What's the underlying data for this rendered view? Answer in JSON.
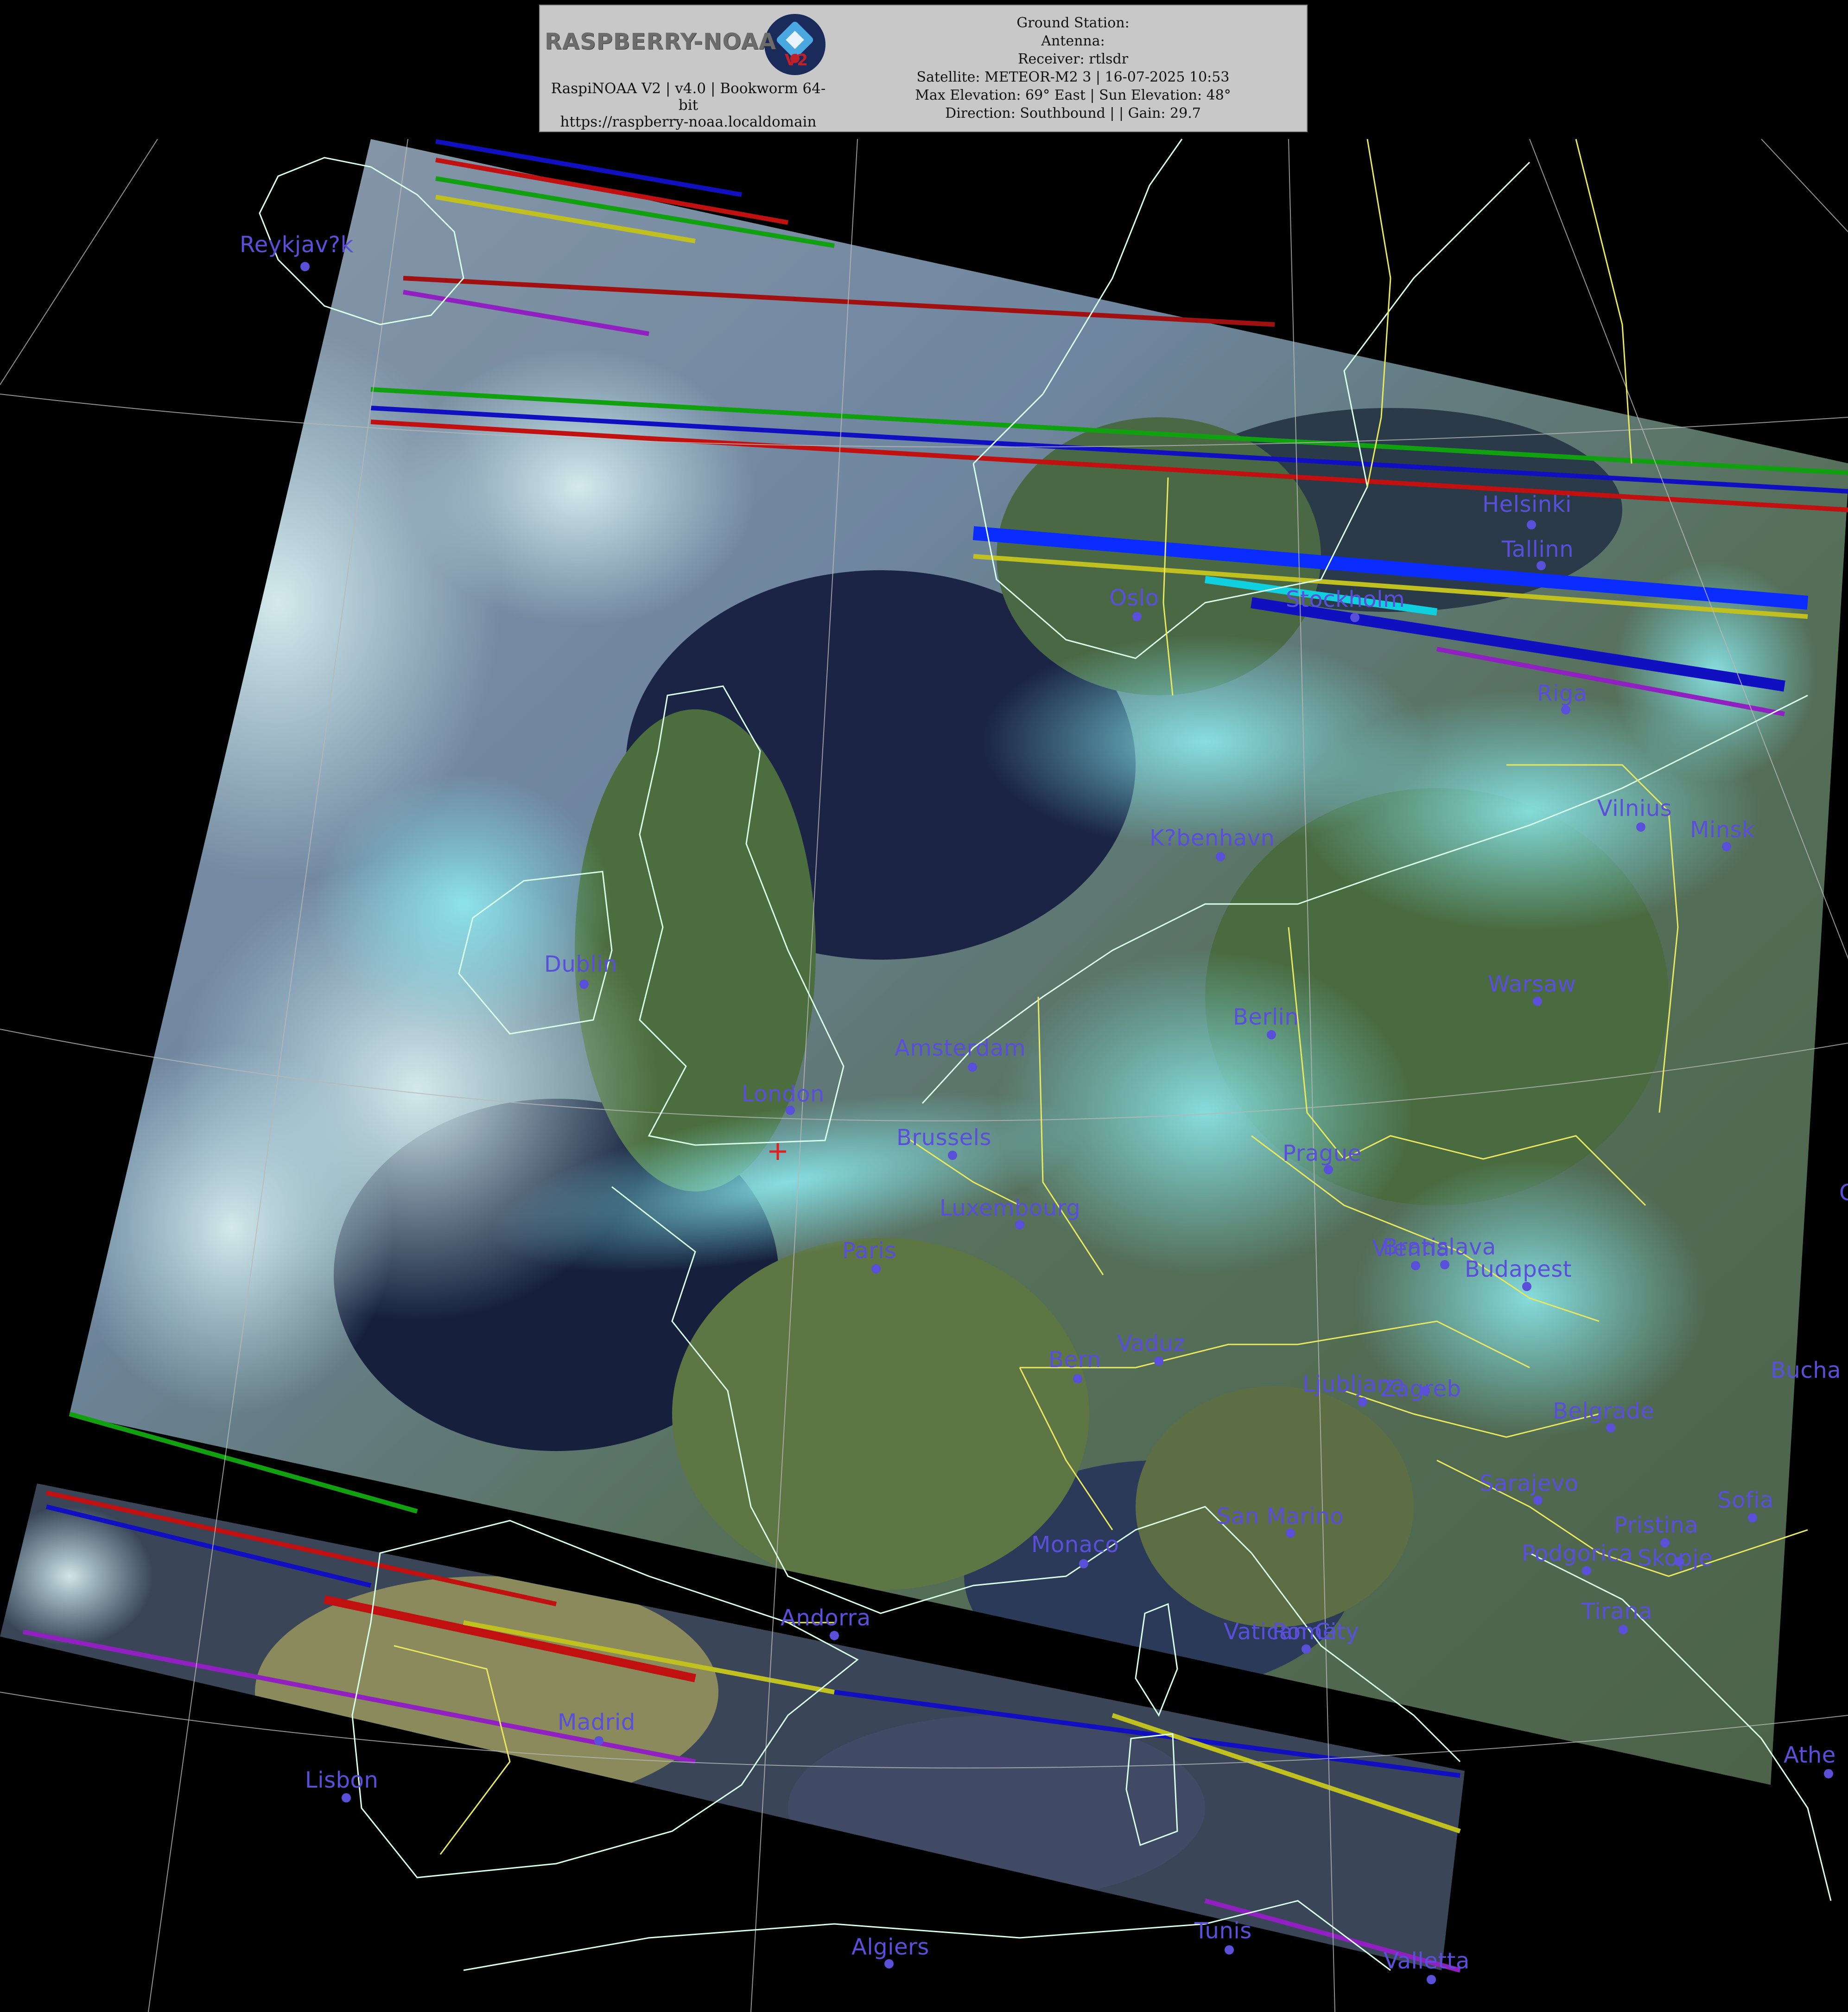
{
  "header": {
    "logo_text": "RASPBERRY-NOAA",
    "logo_version": "V2",
    "station_line1": "RaspiNOAA V2 | v4.0 | Bookworm 64-",
    "station_line1b": "bit",
    "station_url": "https://raspberry-noaa.localdomain",
    "ground_station": "Ground Station:",
    "antenna": "Antenna:",
    "receiver": "Receiver: rtlsdr",
    "satellite": "Satellite: METEOR-M2 3 | 16-07-2025 10:53",
    "elevation": "Max Elevation: 69° East | Sun Elevation: 48°",
    "direction": "Direction: Southbound | | Gain: 29.7"
  },
  "colors": {
    "label": "#5a4fd8",
    "coastline": "#d8ffe8",
    "border": "#e8e860",
    "grid": "#bcbcbc",
    "ground_station_marker": "#e02020"
  },
  "cities": [
    {
      "name": "Reykjav?k"
    },
    {
      "name": "Helsinki"
    },
    {
      "name": "Tallinn"
    },
    {
      "name": "Oslo"
    },
    {
      "name": "Stockholm"
    },
    {
      "name": "Riga"
    },
    {
      "name": "Vilnius"
    },
    {
      "name": "Minsk"
    },
    {
      "name": "K?benhavn"
    },
    {
      "name": "Dublin"
    },
    {
      "name": "Warsaw"
    },
    {
      "name": "Berlin"
    },
    {
      "name": "Amsterdam"
    },
    {
      "name": "London"
    },
    {
      "name": "Brussels"
    },
    {
      "name": "Prague"
    },
    {
      "name": "Luxembourg"
    },
    {
      "name": "Paris"
    },
    {
      "name": "Vienna"
    },
    {
      "name": "Bratislava"
    },
    {
      "name": "Budapest"
    },
    {
      "name": "Vaduz"
    },
    {
      "name": "Bern"
    },
    {
      "name": "Ljubljana"
    },
    {
      "name": "Zagreb"
    },
    {
      "name": "Bucha"
    },
    {
      "name": "Belgrade"
    },
    {
      "name": "Sarajevo"
    },
    {
      "name": "San Marino"
    },
    {
      "name": "Sofia"
    },
    {
      "name": "Pristina"
    },
    {
      "name": "Monaco"
    },
    {
      "name": "Podgorica"
    },
    {
      "name": "Skopje"
    },
    {
      "name": "Tirana"
    },
    {
      "name": "Andorra"
    },
    {
      "name": "Vatican City"
    },
    {
      "name": "Rome"
    },
    {
      "name": "Madrid"
    },
    {
      "name": "Lisbon"
    },
    {
      "name": "Athe"
    },
    {
      "name": "Algiers"
    },
    {
      "name": "Tunis"
    },
    {
      "name": "Valletta"
    },
    {
      "name": "C"
    }
  ]
}
